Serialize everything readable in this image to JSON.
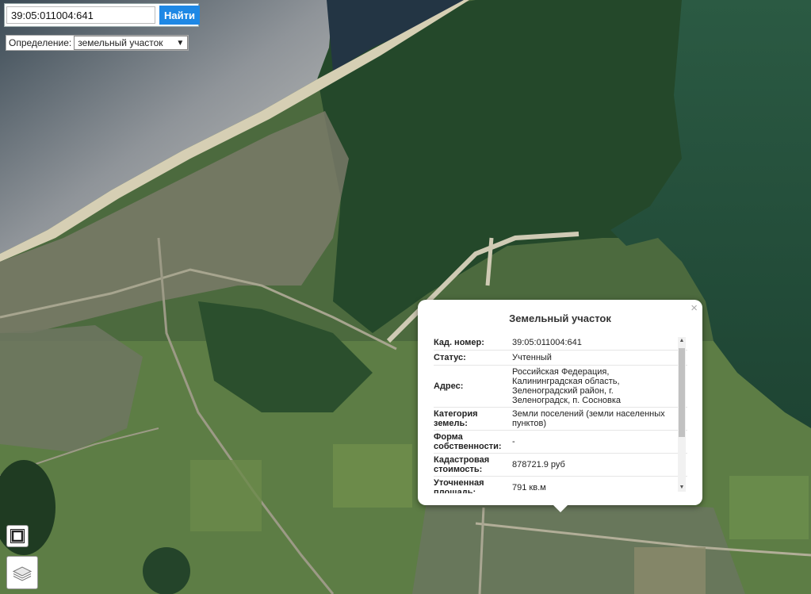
{
  "search": {
    "value": "39:05:011004:641",
    "button_label": "Найти"
  },
  "definition": {
    "label": "Определение:",
    "selected": "земельный участок"
  },
  "popup": {
    "title": "Земельный участок",
    "close_glyph": "×",
    "rows": [
      {
        "key": "Кад. номер:",
        "value": "39:05:011004:641"
      },
      {
        "key": "Статус:",
        "value": "Учтенный"
      },
      {
        "key": "Адрес:",
        "value": "Российская Федерация, Калининградская область, Зеленоградский район, г. Зеленоградск, п. Сосновка"
      },
      {
        "key": "Категория земель:",
        "value": "Земли поселений (земли населенных пунктов)"
      },
      {
        "key": "Форма собственности:",
        "value": "-"
      },
      {
        "key": "Кадастровая стоимость:",
        "value": "878721.9 руб"
      },
      {
        "key": "Уточненная площадь:",
        "value": "791 кв.м"
      }
    ]
  },
  "controls": {
    "frame_icon": "frame-icon",
    "layers_icon": "layers-icon"
  },
  "colors": {
    "accent": "#1e88e5",
    "sea": "#2e3a44",
    "lagoon": "#234a38",
    "forest": "#244a2c"
  }
}
